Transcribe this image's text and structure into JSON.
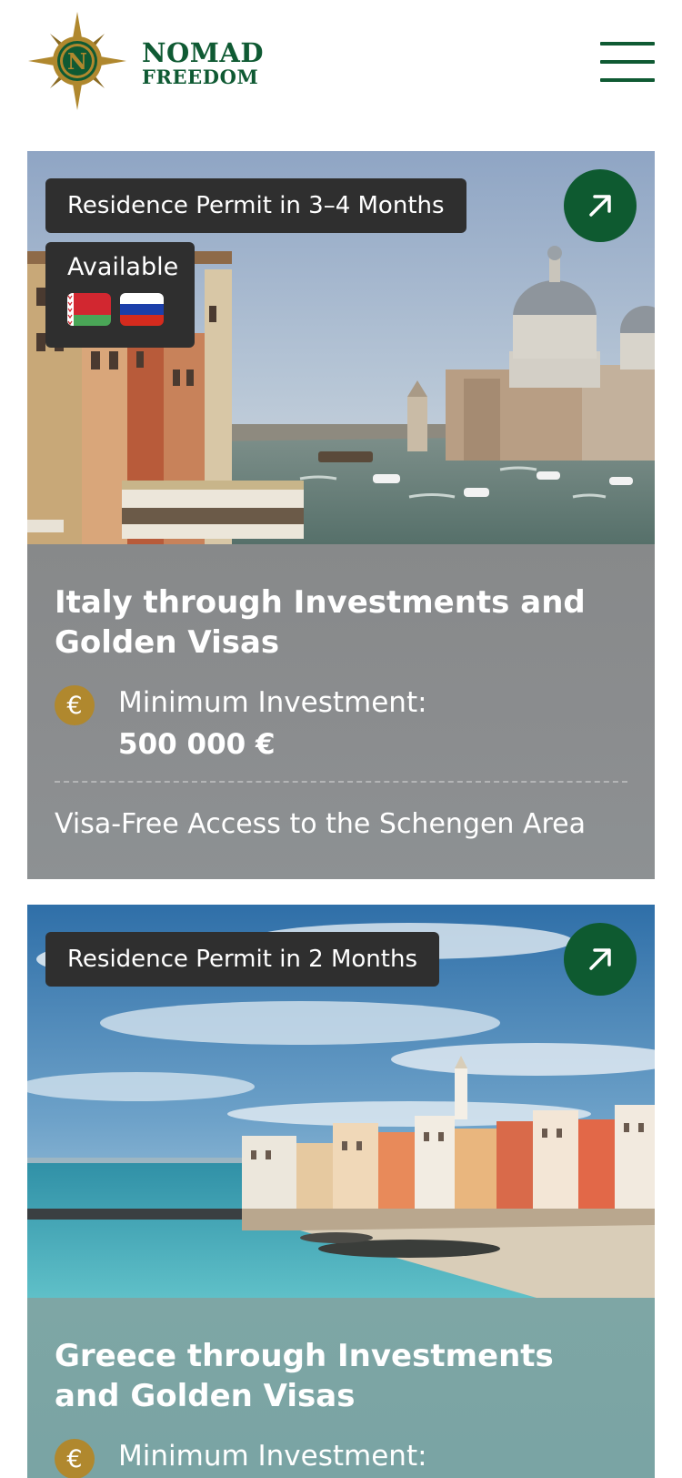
{
  "header": {
    "logo_letter": "N",
    "brand_line1": "NOMAD",
    "brand_line2": "FREEDOM",
    "menu_icon": "hamburger-menu-icon",
    "brand_color": "#0f5a33",
    "gold_color": "#b0882e"
  },
  "cards": [
    {
      "badge": "Residence Permit in 3–4 Months",
      "available_label": "Available",
      "flags": [
        "belarus-flag-icon",
        "russia-flag-icon"
      ],
      "image": "Venice Grand Canal with domed basilica and boats",
      "title": "Italy through Investments and Golden Visas",
      "investment_label": "Minimum Investment:",
      "investment_value": "500 000 €",
      "currency_symbol": "€",
      "feature": "Visa-Free Access to the Schengen Area"
    },
    {
      "badge": "Residence Permit in 2 Months",
      "image": "Seaside town with colorful houses and turquoise water",
      "title": "Greece through Investments and Golden Visas",
      "investment_label": "Minimum Investment:",
      "currency_symbol": "€"
    }
  ],
  "colors": {
    "badge_bg": "#2f2f2f",
    "arrow_button_bg": "#0e5a30",
    "card1_info_bg": "#8b8d8f",
    "card2_info_bg": "#7ea6a5"
  }
}
